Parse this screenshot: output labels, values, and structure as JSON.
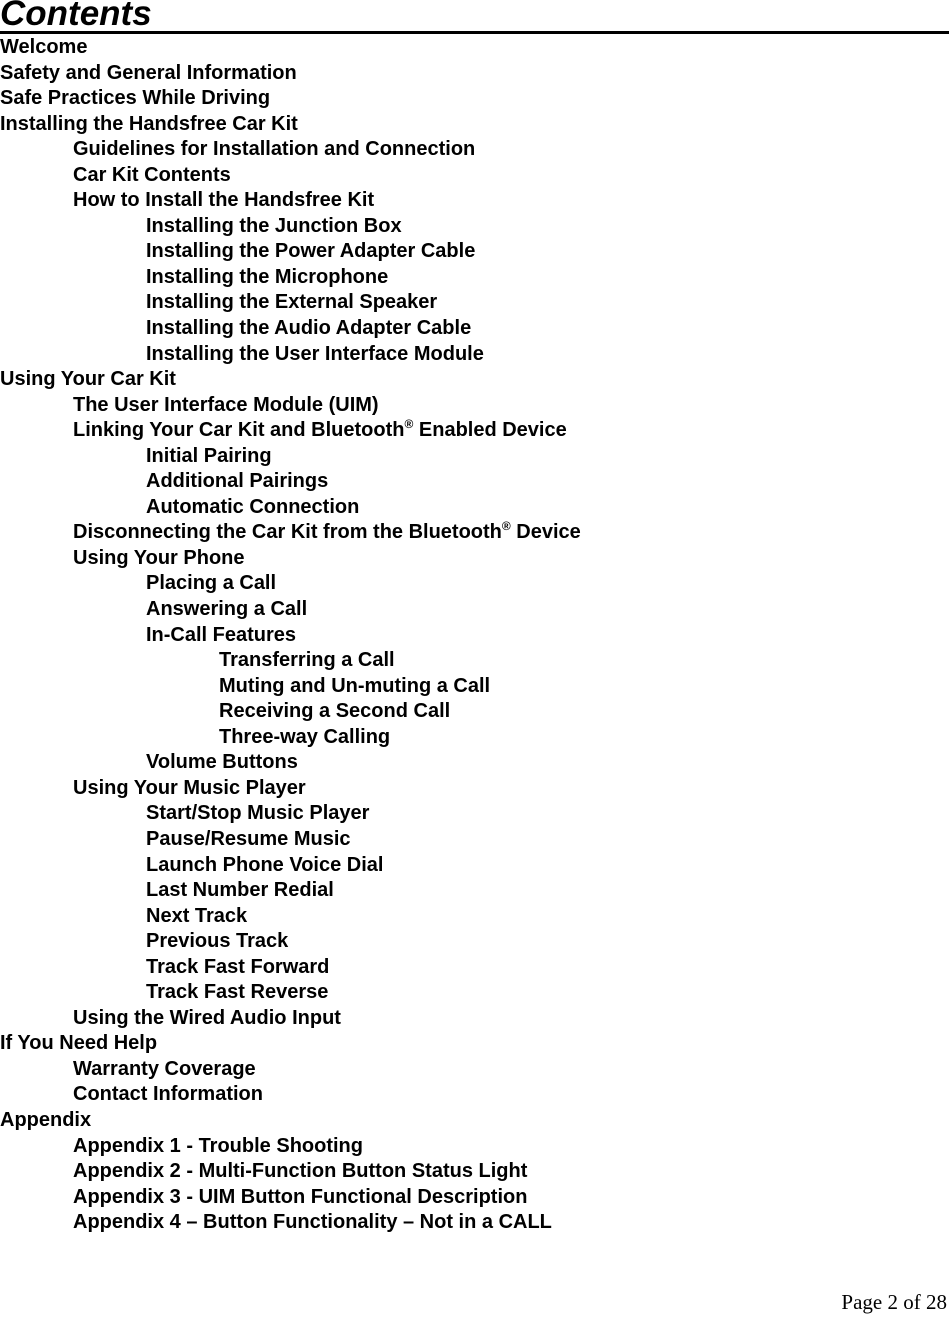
{
  "document": {
    "title": "Contents",
    "toc": [
      {
        "level": 0,
        "text": "Welcome"
      },
      {
        "level": 0,
        "text": "Safety and General Information"
      },
      {
        "level": 0,
        "text": "Safe Practices While Driving"
      },
      {
        "level": 0,
        "text": "Installing the Handsfree Car Kit"
      },
      {
        "level": 1,
        "text": "Guidelines for Installation and Connection"
      },
      {
        "level": 1,
        "text": "Car Kit Contents"
      },
      {
        "level": 1,
        "text": "How to Install the Handsfree Kit"
      },
      {
        "level": 2,
        "text": "Installing the Junction Box"
      },
      {
        "level": 2,
        "text": "Installing the Power Adapter Cable"
      },
      {
        "level": 2,
        "text": "Installing the Microphone"
      },
      {
        "level": 2,
        "text": "Installing the External Speaker"
      },
      {
        "level": 2,
        "text": "Installing the Audio Adapter Cable"
      },
      {
        "level": 2,
        "text": "Installing the User Interface Module"
      },
      {
        "level": 0,
        "text": "Using Your Car Kit"
      },
      {
        "level": 1,
        "text": "The User Interface Module (UIM)"
      },
      {
        "level": 1,
        "text": "Linking Your Car Kit and Bluetooth",
        "sup": "®",
        "after": " Enabled Device"
      },
      {
        "level": 2,
        "text": "Initial Pairing"
      },
      {
        "level": 2,
        "text": "Additional Pairings"
      },
      {
        "level": 2,
        "text": "Automatic Connection"
      },
      {
        "level": 1,
        "text": "Disconnecting the Car Kit from the Bluetooth",
        "sup": "®",
        "after": " Device"
      },
      {
        "level": 1,
        "text": "Using Your Phone"
      },
      {
        "level": 2,
        "text": "Placing a Call"
      },
      {
        "level": 2,
        "text": "Answering a Call"
      },
      {
        "level": 2,
        "text": "In-Call Features"
      },
      {
        "level": 3,
        "text": "Transferring a Call"
      },
      {
        "level": 3,
        "text": "Muting and Un-muting a Call"
      },
      {
        "level": 3,
        "text": "Receiving a Second Call"
      },
      {
        "level": 3,
        "text": "Three-way Calling"
      },
      {
        "level": 2,
        "text": "Volume Buttons"
      },
      {
        "level": 1,
        "text": "Using Your Music Player"
      },
      {
        "level": 2,
        "text": "Start/Stop Music Player"
      },
      {
        "level": 2,
        "text": "Pause/Resume Music"
      },
      {
        "level": 2,
        "text": "Launch Phone Voice Dial"
      },
      {
        "level": 2,
        "text": "Last Number Redial"
      },
      {
        "level": 2,
        "text": "Next Track"
      },
      {
        "level": 2,
        "text": "Previous Track"
      },
      {
        "level": 2,
        "text": "Track Fast Forward"
      },
      {
        "level": 2,
        "text": "Track Fast Reverse"
      },
      {
        "level": 1,
        "text": "Using the Wired Audio Input"
      },
      {
        "level": 0,
        "text": "If You Need Help"
      },
      {
        "level": 1,
        "text": "Warranty Coverage"
      },
      {
        "level": 1,
        "text": "Contact Information"
      },
      {
        "level": 0,
        "text": "Appendix"
      },
      {
        "level": 1,
        "text": "Appendix 1 - Trouble Shooting"
      },
      {
        "level": 1,
        "text": "Appendix 2 - Multi-Function Button Status Light"
      },
      {
        "level": 1,
        "text": "Appendix 3 - UIM Button Functional Description"
      },
      {
        "level": 1,
        "text": "Appendix 4 – Button Functionality – Not in a CALL"
      }
    ],
    "footer": "Page 2 of 28"
  }
}
